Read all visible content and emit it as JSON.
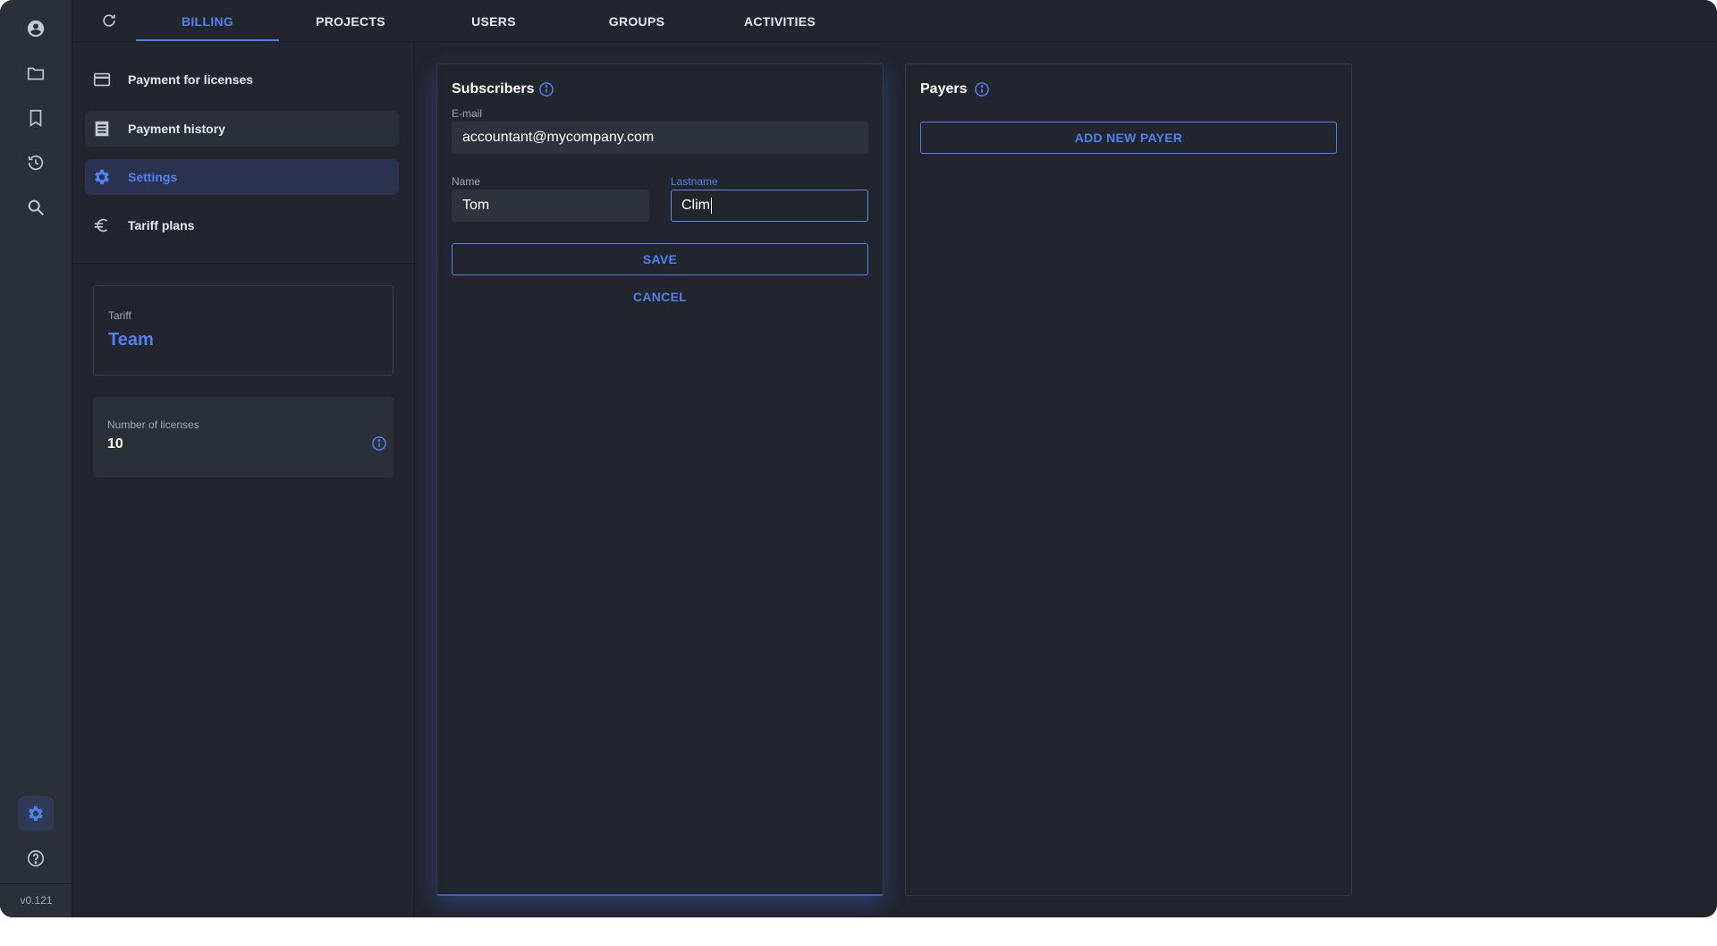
{
  "rail": {
    "items": [
      {
        "name": "account",
        "icon": "account-circle-icon"
      },
      {
        "name": "projects",
        "icon": "folder-icon"
      },
      {
        "name": "bookmarks",
        "icon": "bookmark-icon"
      },
      {
        "name": "history",
        "icon": "history-icon"
      },
      {
        "name": "search",
        "icon": "search-icon"
      }
    ],
    "bottom": [
      {
        "name": "settings",
        "icon": "gear-icon",
        "active": true
      },
      {
        "name": "help",
        "icon": "help-icon"
      }
    ],
    "version": "v0.121"
  },
  "topnav": {
    "tabs": [
      {
        "label": "BILLING",
        "active": true
      },
      {
        "label": "PROJECTS"
      },
      {
        "label": "USERS"
      },
      {
        "label": "GROUPS"
      },
      {
        "label": "ACTIVITIES"
      }
    ]
  },
  "sidebar": {
    "items": [
      {
        "label": "Payment for licenses",
        "icon": "credit-card-icon"
      },
      {
        "label": "Payment history",
        "icon": "list-icon"
      },
      {
        "label": "Settings",
        "icon": "gear-icon",
        "active": true
      },
      {
        "label": "Tariff plans",
        "icon": "euro-icon"
      }
    ],
    "tariff": {
      "label": "Tariff",
      "value": "Team"
    },
    "licenses": {
      "label": "Number of licenses",
      "value": "10"
    }
  },
  "subscribers": {
    "title": "Subscribers",
    "email": {
      "label": "E-mail",
      "value": "accountant@mycompany.com"
    },
    "name": {
      "label": "Name",
      "value": "Tom"
    },
    "lastname": {
      "label": "Lastname",
      "value": "Clim"
    },
    "save_label": "SAVE",
    "cancel_label": "CANCEL"
  },
  "payers": {
    "title": "Payers",
    "add_label": "ADD NEW PAYER"
  },
  "colors": {
    "accent": "#4f82ee",
    "background": "#22252e",
    "rail": "#2b2f38"
  }
}
